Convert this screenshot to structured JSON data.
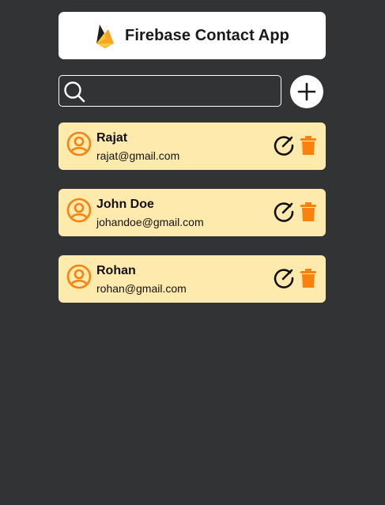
{
  "header": {
    "title": "Firebase Contact App",
    "logo_icon": "firebase-logo-icon"
  },
  "search": {
    "placeholder": "",
    "value": "",
    "icon": "search-icon"
  },
  "add_button": {
    "icon": "plus-icon"
  },
  "colors": {
    "background": "#323334",
    "card": "#ffeaae",
    "accent": "#f9820e"
  },
  "contacts": [
    {
      "name": "Rajat",
      "email": "rajat@gmail.com"
    },
    {
      "name": "John Doe",
      "email": "johandoe@gmail.com"
    },
    {
      "name": "Rohan",
      "email": "rohan@gmail.com"
    }
  ]
}
